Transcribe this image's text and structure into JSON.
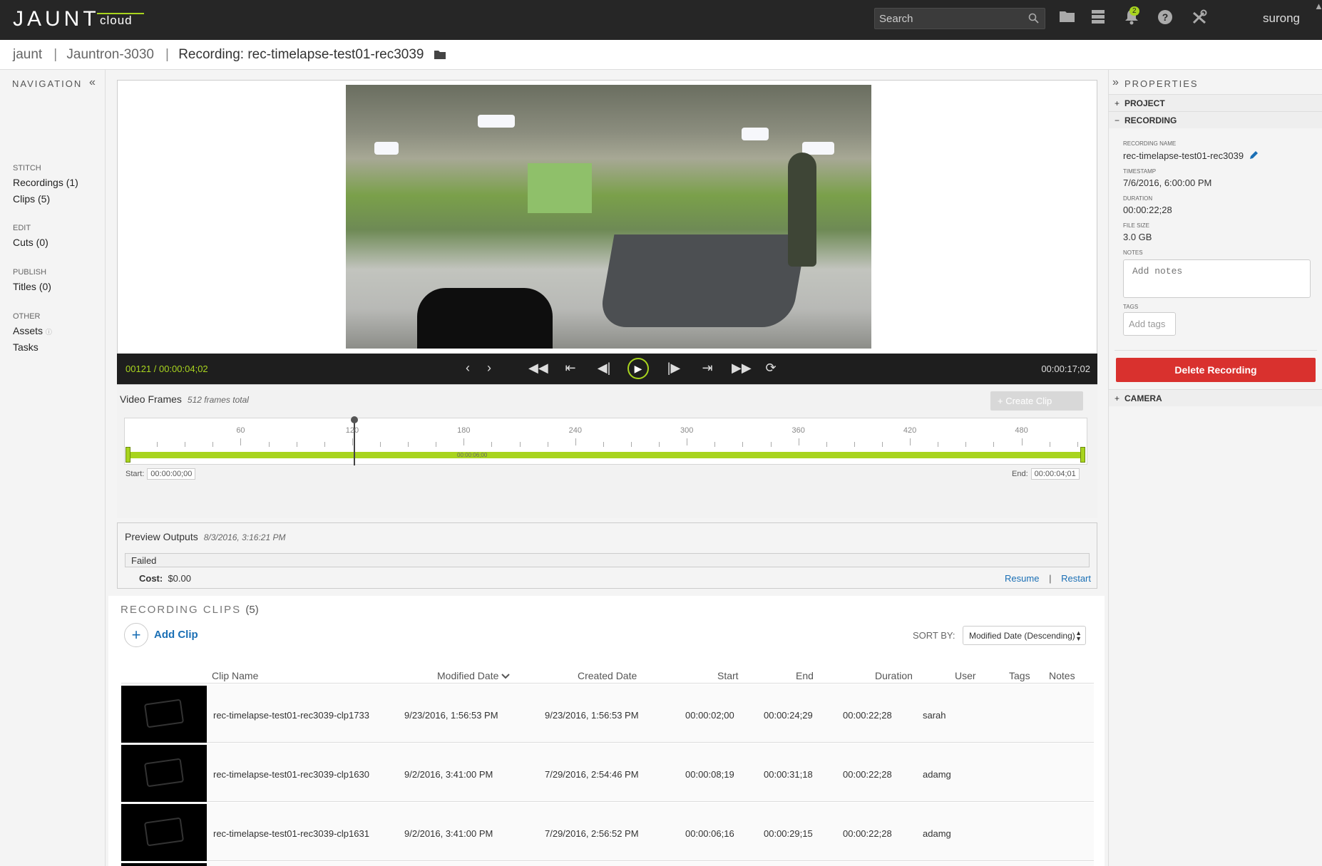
{
  "topbar": {
    "logo": "JAUNT",
    "logo_sub": "cloud",
    "search_placeholder": "Search",
    "notification_count": "2",
    "username": "surong",
    "caret": "▲",
    "icons": [
      "folder-icon",
      "server-icon",
      "bell-icon",
      "help-icon",
      "tools-icon"
    ]
  },
  "breadcrumb": {
    "items": [
      "jaunt",
      "Jauntron-3030"
    ],
    "current": "Recording: rec-timelapse-test01-rec3039"
  },
  "nav": {
    "title": "NAVIGATION",
    "sections": [
      {
        "label": "STITCH",
        "items": [
          "Recordings (1)",
          "Clips (5)"
        ]
      },
      {
        "label": "EDIT",
        "items": [
          "Cuts (0)"
        ]
      },
      {
        "label": "PUBLISH",
        "items": [
          "Titles (0)"
        ]
      },
      {
        "label": "OTHER",
        "items": [
          "Assets",
          "Tasks"
        ]
      }
    ]
  },
  "player": {
    "timecode_left": "00121 / 00:00:04;02",
    "timecode_right": "00:00:17;02"
  },
  "frames": {
    "title": "Video Frames",
    "total": "512 frames total",
    "create_clip": "+ Create Clip",
    "tick_labels": [
      "60",
      "120",
      "180",
      "240",
      "300",
      "360",
      "420",
      "480"
    ],
    "bar_label": "00:00:06;00",
    "start_label": "Start:",
    "start_value": "00:00:00;00",
    "end_label": "End:",
    "end_value": "00:00:04;01",
    "playhead_frame": 121,
    "total_frames": 512
  },
  "preview": {
    "title": "Preview Outputs",
    "timestamp": "8/3/2016, 3:16:21 PM",
    "status": "Failed",
    "cost_label": "Cost:",
    "cost_value": "$0.00",
    "resume": "Resume",
    "separator": "|",
    "restart": "Restart"
  },
  "clips": {
    "title": "RECORDING CLIPS",
    "count": "(5)",
    "add_label": "Add Clip",
    "sort_label": "SORT BY:",
    "sort_value": "Modified Date (Descending)",
    "columns": [
      "Clip Name",
      "Modified Date",
      "Created Date",
      "Start",
      "End",
      "Duration",
      "User",
      "Tags",
      "Notes"
    ],
    "rows": [
      {
        "name": "rec-timelapse-test01-rec3039-clp1733",
        "modified": "9/23/2016, 1:56:53 PM",
        "created": "9/23/2016, 1:56:53 PM",
        "start": "00:00:02;00",
        "end": "00:00:24;29",
        "duration": "00:00:22;28",
        "user": "sarah"
      },
      {
        "name": "rec-timelapse-test01-rec3039-clp1630",
        "modified": "9/2/2016, 3:41:00 PM",
        "created": "7/29/2016, 2:54:46 PM",
        "start": "00:00:08;19",
        "end": "00:00:31;18",
        "duration": "00:00:22;28",
        "user": "adamg"
      },
      {
        "name": "rec-timelapse-test01-rec3039-clp1631",
        "modified": "9/2/2016, 3:41:00 PM",
        "created": "7/29/2016, 2:56:52 PM",
        "start": "00:00:06;16",
        "end": "00:00:29;15",
        "duration": "00:00:22;28",
        "user": "adamg"
      }
    ]
  },
  "properties": {
    "title": "PROPERTIES",
    "project": "PROJECT",
    "recording": "RECORDING",
    "camera": "CAMERA",
    "fields": {
      "name_label": "RECORDING NAME",
      "name_value": "rec-timelapse-test01-rec3039",
      "timestamp_label": "TIMESTAMP",
      "timestamp_value": "7/6/2016, 6:00:00 PM",
      "duration_label": "DURATION",
      "duration_value": "00:00:22;28",
      "filesize_label": "FILE SIZE",
      "filesize_value": "3.0 GB",
      "notes_label": "NOTES",
      "notes_placeholder": "Add notes",
      "tags_label": "TAGS",
      "tags_placeholder": "Add tags"
    },
    "delete_button": "Delete Recording"
  },
  "colors": {
    "accent": "#a8d41e",
    "danger": "#d9312e",
    "link": "#1a6fb5",
    "topbar": "#262626"
  }
}
